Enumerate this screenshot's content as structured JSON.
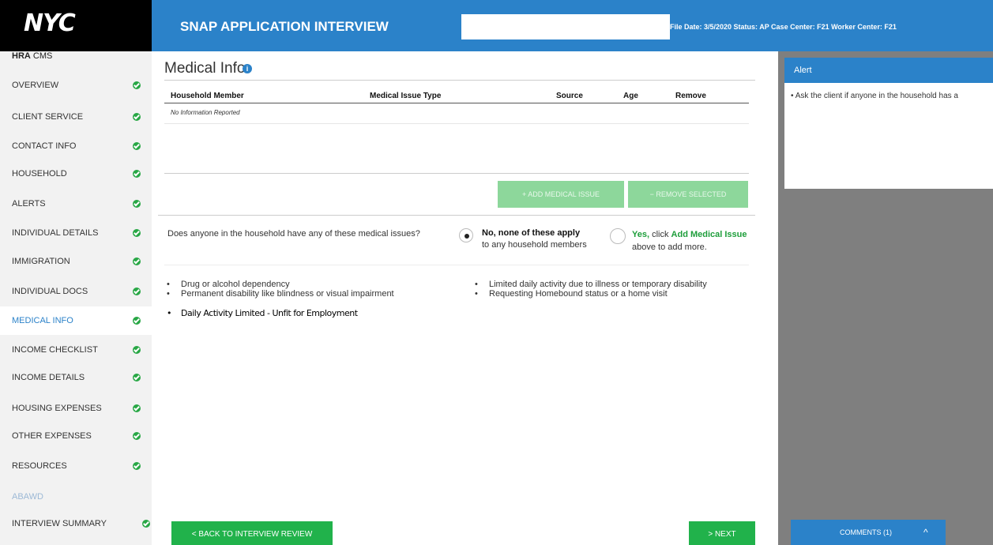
{
  "header": {
    "logo": "NYC",
    "app_title": "SNAP APPLICATION INTERVIEW",
    "file_meta": "File Date: 3/5/2020  Status: AP  Case Center: F21  Worker Center: F21"
  },
  "sidebar": {
    "brand_bold": "HRA",
    "brand_rest": " CMS",
    "items": [
      {
        "label": "OVERVIEW"
      },
      {
        "label": "CLIENT SERVICE"
      },
      {
        "label": "CONTACT INFO"
      },
      {
        "label": "HOUSEHOLD"
      },
      {
        "label": "ALERTS"
      },
      {
        "label": "INDIVIDUAL DETAILS"
      },
      {
        "label": "IMMIGRATION"
      },
      {
        "label": "INDIVIDUAL DOCS"
      },
      {
        "label": "MEDICAL INFO"
      },
      {
        "label": "INCOME CHECKLIST"
      },
      {
        "label": "INCOME DETAILS"
      },
      {
        "label": "HOUSING EXPENSES"
      },
      {
        "label": "OTHER EXPENSES"
      },
      {
        "label": "RESOURCES"
      },
      {
        "label": "ABAWD"
      },
      {
        "label": "INTERVIEW SUMMARY"
      }
    ]
  },
  "main": {
    "title": "Medical Info",
    "info_icon": "i",
    "table": {
      "columns": [
        "Household Member",
        "Medical Issue Type",
        "Source",
        "Age",
        "Remove"
      ],
      "empty_text": "No Information Reported"
    },
    "add_button": "+ ADD MEDICAL ISSUE",
    "remove_button": "− REMOVE SELECTED",
    "question": "Does anyone in the household have any of these medical issues?",
    "option_no_main": "No, none of these apply",
    "option_no_sub": "to any household members",
    "option_yes_pre": "Yes,",
    "option_yes_mid": " click ",
    "option_yes_link": "Add Medical Issue",
    "option_yes_post": " above to add more.",
    "issues_left": [
      "Drug or alcohol dependency",
      "Permanent disability like blindness or visual impairment",
      "Daily Activity Limited - Unfit for Employment"
    ],
    "issues_right": [
      "Limited daily activity due to illness or temporary disability",
      "Requesting Homebound status or a home visit"
    ],
    "back_button": "<  BACK TO INTERVIEW REVIEW",
    "next_button": ">  NEXT"
  },
  "right_panel": {
    "alert_title": "Alert",
    "alert_text": "Ask the client if anyone in the household has a",
    "comments_label": "COMMENTS (1)",
    "comments_caret": "^"
  }
}
